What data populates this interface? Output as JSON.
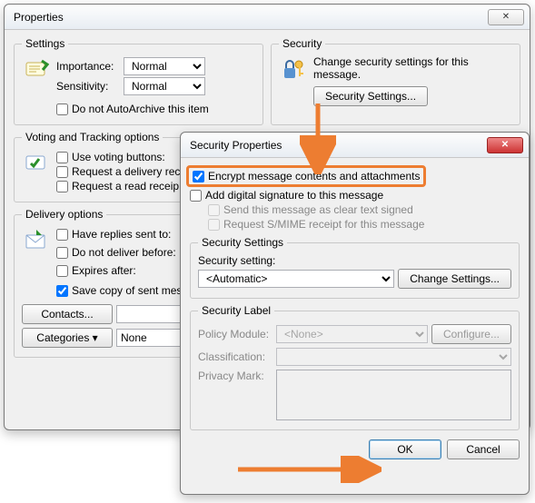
{
  "props": {
    "title": "Properties",
    "settings": {
      "legend": "Settings",
      "importance_label": "Importance:",
      "importance_value": "Normal",
      "sensitivity_label": "Sensitivity:",
      "sensitivity_value": "Normal",
      "autoarchive_label": "Do not AutoArchive this item"
    },
    "security": {
      "legend": "Security",
      "desc": "Change security settings for this message.",
      "button": "Security Settings..."
    },
    "voting": {
      "legend": "Voting and Tracking options",
      "use_voting": "Use voting buttons:",
      "req_delivery": "Request a delivery rec",
      "req_read": "Request a read receip"
    },
    "delivery": {
      "legend": "Delivery options",
      "replies_to": "Have replies sent to:",
      "deliver_before": "Do not deliver before:",
      "expires_after": "Expires after:",
      "save_copy": "Save copy of sent mes",
      "contacts": "Contacts...",
      "categories": "Categories",
      "categories_value": "None"
    }
  },
  "sec": {
    "title": "Security Properties",
    "encrypt": "Encrypt message contents and attachments",
    "sign": "Add digital signature to this message",
    "clear_text": "Send this message as clear text signed",
    "smime": "Request S/MIME receipt for this message",
    "settings_legend": "Security Settings",
    "setting_label": "Security setting:",
    "setting_value": "<Automatic>",
    "change_settings": "Change Settings...",
    "label_legend": "Security Label",
    "policy_label": "Policy Module:",
    "policy_value": "<None>",
    "configure": "Configure...",
    "classification_label": "Classification:",
    "privacy_label": "Privacy Mark:",
    "ok": "OK",
    "cancel": "Cancel"
  }
}
